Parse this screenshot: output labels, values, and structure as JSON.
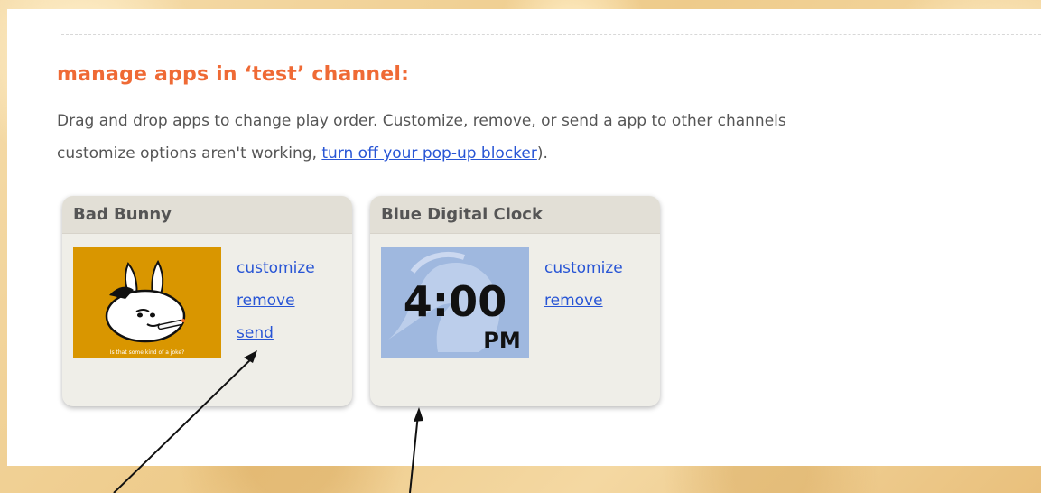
{
  "page": {
    "title": "manage apps in ‘test’ channel:",
    "description_prefix": "Drag and drop apps to change play order. Customize, remove, or send a app to other channels",
    "description_line2_prefix": "customize options aren't working, ",
    "popup_link": "turn off your pop-up blocker",
    "description_suffix": ")."
  },
  "apps": [
    {
      "name": "Bad Bunny",
      "thumbnail_caption": "Is that some kind of a joke?",
      "actions": {
        "customize": "customize",
        "remove": "remove",
        "send": "send"
      }
    },
    {
      "name": "Blue Digital Clock",
      "clock_time": "4:00",
      "clock_ampm": "PM",
      "actions": {
        "customize": "customize",
        "remove": "remove"
      }
    }
  ],
  "colors": {
    "title": "#ef6a35",
    "link": "#2855d5",
    "card": "#efeee8",
    "card_header": "#e2dfd6",
    "bunny_bg": "#d99600",
    "clock_bg": "#9fb8df",
    "page_bg": "#f3d8a4"
  }
}
